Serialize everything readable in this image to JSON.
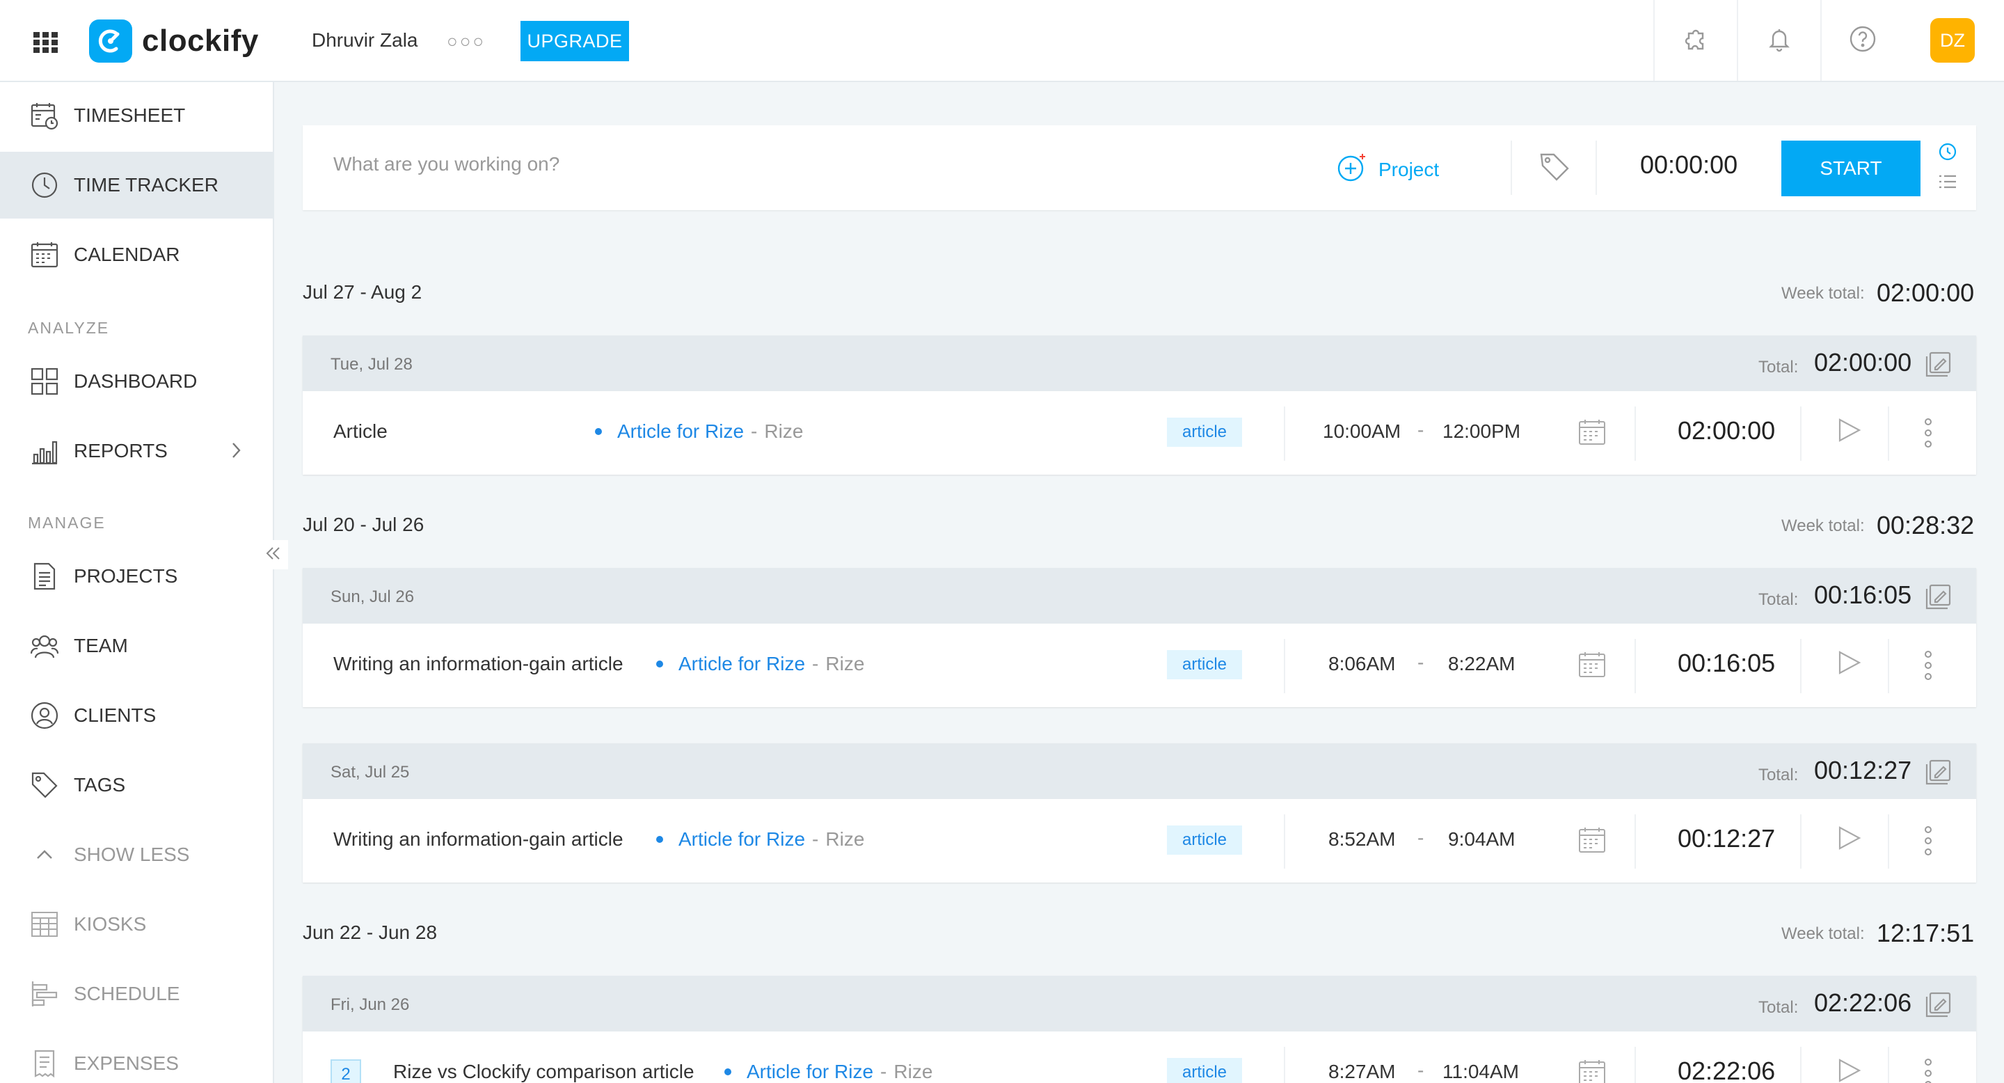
{
  "app": {
    "logo_text": "clockify",
    "workspace": "Dhruvir Zala",
    "upgrade_label": "UPGRADE",
    "avatar_initials": "DZ",
    "accent_color": "#03a9f4"
  },
  "sidebar": {
    "items": [
      {
        "label": "TIMESHEET",
        "icon": "timesheet-icon"
      },
      {
        "label": "TIME TRACKER",
        "icon": "clock-icon"
      },
      {
        "label": "CALENDAR",
        "icon": "calendar-icon"
      }
    ],
    "analyze_label": "ANALYZE",
    "analyze_items": [
      {
        "label": "DASHBOARD",
        "icon": "dashboard-icon"
      },
      {
        "label": "REPORTS",
        "icon": "reports-icon"
      }
    ],
    "manage_label": "MANAGE",
    "manage_items": [
      {
        "label": "PROJECTS",
        "icon": "projects-icon"
      },
      {
        "label": "TEAM",
        "icon": "team-icon"
      },
      {
        "label": "CLIENTS",
        "icon": "clients-icon"
      },
      {
        "label": "TAGS",
        "icon": "tag-icon"
      }
    ],
    "show_less_label": "SHOW LESS",
    "extra_items": [
      {
        "label": "KIOSKS",
        "icon": "kiosk-icon"
      },
      {
        "label": "SCHEDULE",
        "icon": "schedule-icon"
      },
      {
        "label": "EXPENSES",
        "icon": "expenses-icon"
      }
    ]
  },
  "timer": {
    "placeholder": "What are you working on?",
    "project_label": "Project",
    "display": "00:00:00",
    "start_label": "START"
  },
  "weeks": [
    {
      "range": "Jul 27 - Aug 2",
      "total_label": "Week total:",
      "total": "02:00:00",
      "days": [
        {
          "date": "Tue, Jul 28",
          "total_label": "Total:",
          "total": "02:00:00",
          "entry": {
            "description": "Article",
            "project": "Article for Rize",
            "client": "Rize",
            "tag": "article",
            "start": "10:00AM",
            "end": "12:00PM",
            "duration": "02:00:00"
          }
        }
      ]
    },
    {
      "range": "Jul 20 - Jul 26",
      "total_label": "Week total:",
      "total": "00:28:32",
      "days": [
        {
          "date": "Sun, Jul 26",
          "total_label": "Total:",
          "total": "00:16:05",
          "entry": {
            "description": "Writing an information-gain article",
            "project": "Article for Rize",
            "client": "Rize",
            "tag": "article",
            "start": "8:06AM",
            "end": "8:22AM",
            "duration": "00:16:05"
          }
        },
        {
          "date": "Sat, Jul 25",
          "total_label": "Total:",
          "total": "00:12:27",
          "entry": {
            "description": "Writing an information-gain article",
            "project": "Article for Rize",
            "client": "Rize",
            "tag": "article",
            "start": "8:52AM",
            "end": "9:04AM",
            "duration": "00:12:27"
          }
        }
      ]
    },
    {
      "range": "Jun 22 - Jun 28",
      "total_label": "Week total:",
      "total": "12:17:51",
      "days": [
        {
          "date": "Fri, Jun 26",
          "total_label": "Total:",
          "total": "02:22:06",
          "entry": {
            "count": "2",
            "description": "Rize vs Clockify comparison article",
            "project": "Article for Rize",
            "client": "Rize",
            "tag": "article",
            "start": "8:27AM",
            "end": "11:04AM",
            "duration": "02:22:06"
          }
        }
      ]
    }
  ]
}
